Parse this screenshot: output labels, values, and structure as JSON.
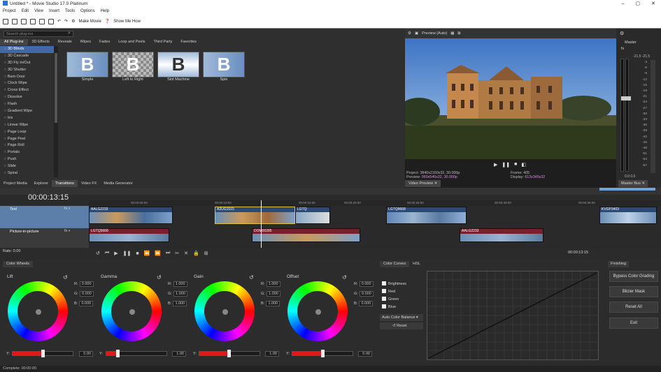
{
  "window": {
    "title": "Untitled * - Movie Studio 17.0 Platinum",
    "min": "–",
    "max": "▢",
    "close": "✕"
  },
  "menu": [
    "Project",
    "Edit",
    "View",
    "Insert",
    "Tools",
    "Options",
    "Help"
  ],
  "toolbar": {
    "make_movie": "Make Movie",
    "show_me_how": "Show Me How"
  },
  "plugins": {
    "search_placeholder": "Search plug-ins",
    "tabs": [
      "All Plug-ins",
      "3D Effects",
      "Reveals",
      "Wipes",
      "Fades",
      "Loop and Peels",
      "Third Party",
      "Favorites"
    ],
    "list": [
      "3D Blinds",
      "3D Cascade",
      "3D Fly In/Out",
      "3D Shutter",
      "Barn Door",
      "Clock Wipe",
      "Cross Effect",
      "Dissolve",
      "Flash",
      "Gradient Wipe",
      "Iris",
      "Linear Wipe",
      "Page Loop",
      "Page Peel",
      "Page Roll",
      "Portals",
      "Push",
      "Slide",
      "Spiral"
    ],
    "thumbs": [
      "Simple",
      "Left to Right",
      "Slot Machine",
      "Spin"
    ],
    "thumb_glyph": "B"
  },
  "bottom_tabs": [
    "Project Media",
    "Explorer",
    "Transitions",
    "Video FX",
    "Media Generator"
  ],
  "preview": {
    "mode": "Preview (Auto)",
    "project_label": "Project:",
    "project_value": "3840x2160x32, 30.000p",
    "preview_label": "Preview:",
    "preview_value": "960x540x32, 30.000p",
    "frame_label": "Frame:",
    "frame_value": "405",
    "display_label": "Display:",
    "display_value": "613x345x32",
    "tab": "Video Preview"
  },
  "master": {
    "title": "Master",
    "tab": "Master Bus",
    "scale": [
      "-3",
      "-6",
      "-9",
      "-12",
      "-15",
      "-18",
      "-21",
      "-24",
      "-27",
      "-30",
      "-33",
      "-36",
      "-39",
      "-42",
      "-45",
      "-48",
      "-51",
      "-54",
      "-57"
    ],
    "top_values": [
      "-21.5",
      "-21.5"
    ],
    "bottom_values": [
      "0.0",
      "0.0"
    ],
    "bus_values": [
      "-Inf.",
      "-Inf."
    ]
  },
  "timeline": {
    "timecode": "00:00:13:15",
    "ruler": [
      "00:00:00:00",
      "00:00:05:00",
      "00:00:10:00",
      "00:00:15:00",
      "00:00:20:00",
      "00:00:25:00",
      "00:00:30:00",
      "00:00:35:00",
      "00:00:40:00",
      "00:00:45:00"
    ],
    "tracks": [
      {
        "name": "Text"
      },
      {
        "name": "Picture-in-picture"
      }
    ],
    "clips_top": [
      "AALG2233",
      "A2UG1515",
      "LGTQ",
      "LGTQ9668",
      "KVGP3403"
    ],
    "clips_bottom": [
      "LGTQ5668",
      "DOM00285",
      "AALG2233"
    ],
    "rate": "Rate: 0.00",
    "end_timecode": "00:00:13:15"
  },
  "color_wheels": {
    "tab": "Color Wheels",
    "wheels": [
      {
        "name": "Lift",
        "r": "0.000",
        "g": "0.000",
        "b": "0.000",
        "y": "0.00"
      },
      {
        "name": "Gamma",
        "r": "1.000",
        "g": "1.000",
        "b": "1.000",
        "y": "1.00"
      },
      {
        "name": "Gain",
        "r": "1.000",
        "g": "1.000",
        "b": "1.000",
        "y": "1.00"
      },
      {
        "name": "Offset",
        "r": "0.000",
        "g": "0.000",
        "b": "0.000",
        "y": "0.00"
      }
    ],
    "r_label": "R:",
    "g_label": "G:",
    "b_label": "B:",
    "y_label": "Y:"
  },
  "color_curves": {
    "tabs": [
      "Color Curves",
      "HSL"
    ],
    "checks": [
      "Brightness",
      "Red",
      "Green",
      "Blue"
    ],
    "auto": "Auto Color Balance",
    "reset": "Reset"
  },
  "finishing": {
    "tab": "Finishing",
    "buttons": [
      "Bypass Color Grading",
      "Blizier Mask",
      "Reset All",
      "Exit"
    ]
  },
  "status": "Complete: 00:00:00"
}
